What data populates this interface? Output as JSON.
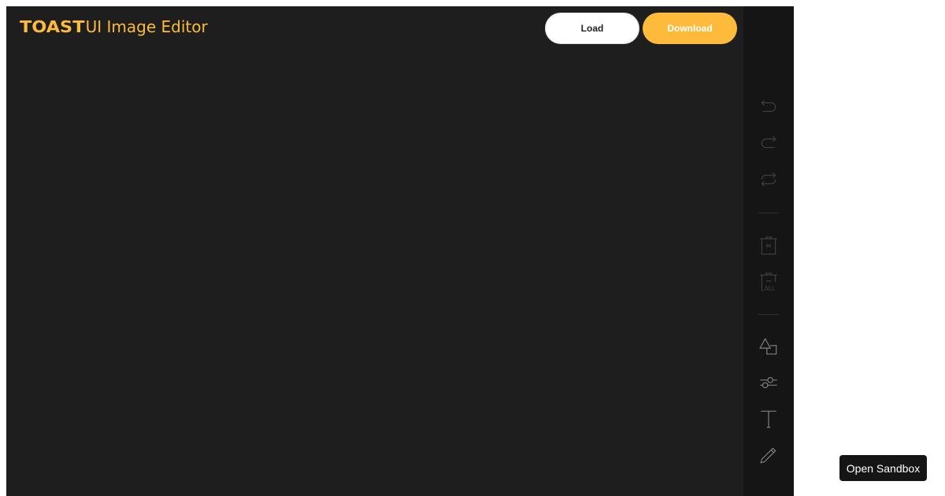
{
  "header": {
    "logo_brand": "TOAST",
    "logo_product": "UI Image Editor",
    "load_label": "Load",
    "download_label": "Download"
  },
  "menu": {
    "items": [
      {
        "name": "undo",
        "icon": "undo-icon"
      },
      {
        "name": "redo",
        "icon": "redo-icon"
      },
      {
        "name": "reset",
        "icon": "reset-icon"
      },
      {
        "name": "delete",
        "icon": "delete-icon"
      },
      {
        "name": "delete-all",
        "icon": "delete-all-icon",
        "icon_text": "ALL"
      },
      {
        "name": "shape",
        "icon": "shape-icon"
      },
      {
        "name": "filter",
        "icon": "filter-sliders-icon"
      },
      {
        "name": "text",
        "icon": "text-icon"
      },
      {
        "name": "draw",
        "icon": "pencil-icon"
      }
    ]
  },
  "colors": {
    "accent": "#fdba3b",
    "editor_bg": "#1e1e1e",
    "menu_bg": "#151515",
    "icon_disabled": "#434343",
    "icon_enabled": "#8a8a8a"
  },
  "sandbox_button": {
    "label": "Open Sandbox"
  }
}
